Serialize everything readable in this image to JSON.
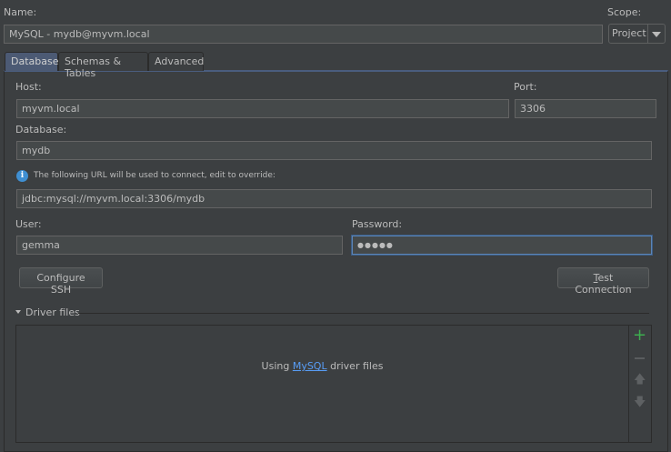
{
  "name": {
    "label": "Name:",
    "value": "MySQL - mydb@myvm.local"
  },
  "scope": {
    "label": "Scope:",
    "value": "Project"
  },
  "tabs": [
    {
      "label": "Database"
    },
    {
      "label": "Schemas & Tables"
    },
    {
      "label": "Advanced"
    }
  ],
  "host": {
    "label": "Host:",
    "value": "myvm.local"
  },
  "port": {
    "label": "Port:",
    "value": "3306"
  },
  "database": {
    "label": "Database:",
    "value": "mydb"
  },
  "info": {
    "text": "The following URL will be used to connect, edit to override:"
  },
  "url": {
    "value": "jdbc:mysql://myvm.local:3306/mydb"
  },
  "user": {
    "label": "User:",
    "value": "gemma"
  },
  "password": {
    "label": "Password:",
    "value": "●●●●●"
  },
  "buttons": {
    "configure_ssh": "Configure SSH",
    "test_connection_mnemonic": "T",
    "test_connection_rest": "est Connection"
  },
  "driver_files": {
    "title": "Driver files",
    "using": "Using ",
    "link": "MySQL",
    "suffix": " driver files"
  },
  "colors": {
    "accent": "#4a5d7e",
    "link": "#589df6",
    "add": "#3dae4f"
  }
}
